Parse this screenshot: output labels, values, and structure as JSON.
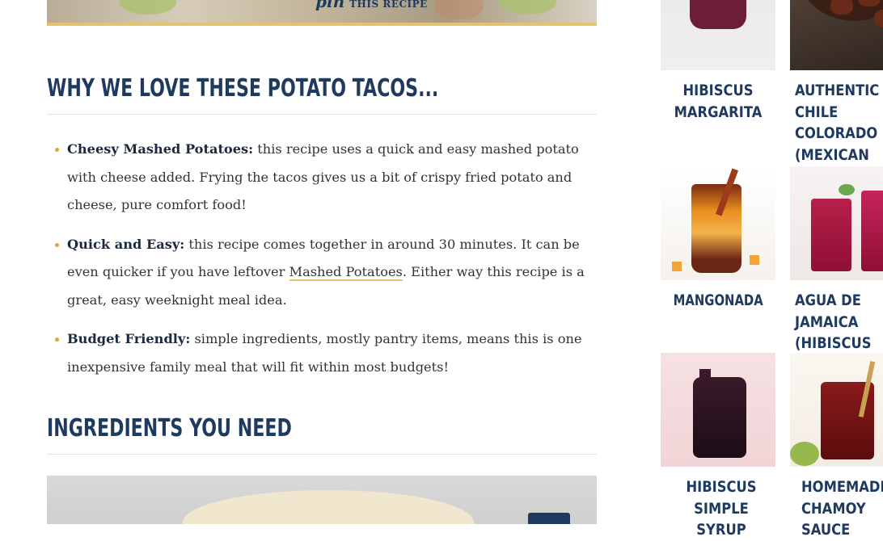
{
  "hero": {
    "pin_icon_name": "pinterest-icon",
    "pin_glyph": "pin",
    "pin_label": "THIS RECIPE"
  },
  "sections": {
    "why_title": "WHY WE LOVE THESE POTATO TACOS...",
    "ingredients_title": "INGREDIENTS YOU NEED"
  },
  "bullets": [
    {
      "bold": "Cheesy Mashed Potatoes:",
      "text": " this recipe uses a quick and easy mashed potato with cheese added. Frying the tacos gives us a bit of crispy fried potato and cheese, pure comfort food!"
    },
    {
      "bold": "Quick and Easy:",
      "text_before": " this recipe comes together in around 30 minutes. It can be even quicker if you have leftover ",
      "link": "Mashed Potatoes",
      "text_after": ". Either way this recipe is a great, easy weeknight meal idea."
    },
    {
      "bold": "Budget Friendly:",
      "text": " simple ingredients, mostly pantry items, means this is one inexpensive family meal that will fit within most budgets!"
    }
  ],
  "sidebar": {
    "cards": [
      {
        "title": "HIBISCUS MARGARITA"
      },
      {
        "title": "AUTHENTIC CHILE COLORADO (MEXICAN STEW)"
      },
      {
        "title": "MANGONADA"
      },
      {
        "title": "AGUA DE JAMAICA (HIBISCUS TEA)"
      },
      {
        "title": "HIBISCUS SIMPLE SYRUP"
      },
      {
        "title": "HOMEMADE CHAMOY SAUCE"
      }
    ]
  },
  "colors": {
    "heading": "#1f3a5f",
    "accent_gold": "#e2c46f",
    "bullet_dot": "#d9a93a"
  }
}
